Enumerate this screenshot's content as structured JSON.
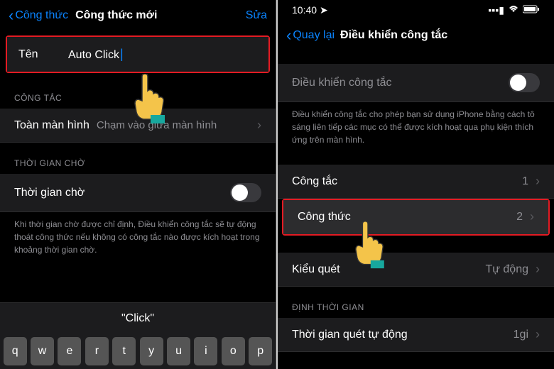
{
  "left": {
    "nav": {
      "back": "Công thức",
      "title": "Công thức mới",
      "action": "Sửa"
    },
    "name_row": {
      "label": "Tên",
      "value": "Auto Click"
    },
    "section_switch": "CÔNG TẮC",
    "fullscreen": {
      "label": "Toàn màn hình",
      "value": "Chạm vào giữa màn hình"
    },
    "section_timeout": "THỜI GIAN CHỜ",
    "timeout": {
      "label": "Thời gian chờ"
    },
    "timeout_note": "Khi thời gian chờ được chỉ định, Điều khiển công tắc sẽ tự động thoát công thức nếu không có công tắc nào được kích hoạt trong khoảng thời gian chờ.",
    "suggestion": "\"Click\"",
    "keys": [
      "q",
      "w",
      "e",
      "r",
      "t",
      "y",
      "u",
      "i",
      "o",
      "p"
    ]
  },
  "right": {
    "status": {
      "time": "10:40"
    },
    "nav": {
      "back": "Quay lại",
      "title": "Điều khiển công tắc"
    },
    "switch_control": {
      "label": "Điều khiển công tắc"
    },
    "switch_note": "Điều khiển công tắc cho phép bạn sử dụng iPhone bằng cách tô sáng liên tiếp các mục có thể được kích hoạt qua phụ kiện thích ứng trên màn hình.",
    "switches": {
      "label": "Công tắc",
      "value": "1"
    },
    "recipes": {
      "label": "Công thức",
      "value": "2"
    },
    "scan_style": {
      "label": "Kiểu quét",
      "value": "Tự động"
    },
    "section_timing": "ĐỊNH THỜI GIAN",
    "auto_scan": {
      "label": "Thời gian quét tự động",
      "value": "1gi"
    }
  }
}
